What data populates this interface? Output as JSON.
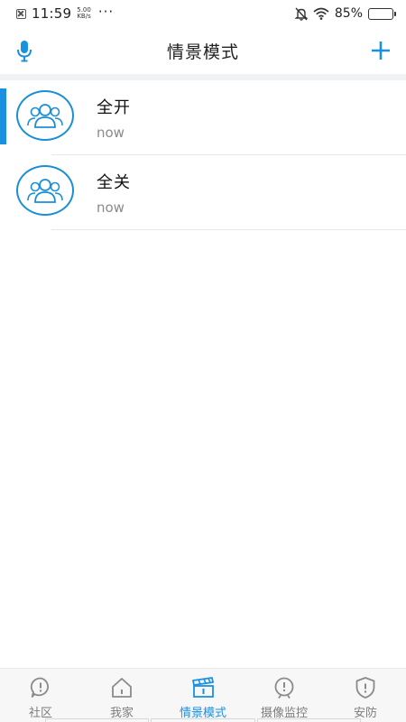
{
  "status_bar": {
    "time": "11:59",
    "speed_value": "5.00",
    "speed_unit": "KB/s",
    "more": "···",
    "battery_text": "85%",
    "battery_level": 0.85
  },
  "header": {
    "title": "情景模式",
    "accent_color": "#1a90e0"
  },
  "scenes": [
    {
      "name": "全开",
      "time": "now",
      "icon": "group-icon",
      "selected": true
    },
    {
      "name": "全关",
      "time": "now",
      "icon": "group-icon",
      "selected": false
    }
  ],
  "tabbar": {
    "active_index": 2,
    "tabs": [
      {
        "label": "社区",
        "icon": "community-icon"
      },
      {
        "label": "我家",
        "icon": "home-icon"
      },
      {
        "label": "情景模式",
        "icon": "clapperboard-icon"
      },
      {
        "label": "摄像监控",
        "icon": "camera-icon"
      },
      {
        "label": "安防",
        "icon": "shield-icon"
      }
    ]
  }
}
